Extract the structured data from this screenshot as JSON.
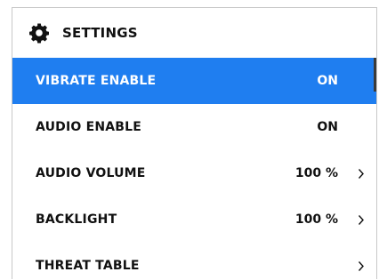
{
  "header": {
    "title": "SETTINGS",
    "icon": "gear-icon"
  },
  "colors": {
    "selected_background": "#1f7ef0",
    "selected_text": "#ffffff",
    "text": "#111111"
  },
  "items": [
    {
      "label": "VIBRATE ENABLE",
      "value": "ON",
      "has_submenu": false,
      "selected": true
    },
    {
      "label": "AUDIO ENABLE",
      "value": "ON",
      "has_submenu": false,
      "selected": false
    },
    {
      "label": "AUDIO VOLUME",
      "value": "100 %",
      "has_submenu": true,
      "selected": false
    },
    {
      "label": "BACKLIGHT",
      "value": "100 %",
      "has_submenu": true,
      "selected": false
    },
    {
      "label": "THREAT TABLE",
      "value": "",
      "has_submenu": true,
      "selected": false
    }
  ]
}
